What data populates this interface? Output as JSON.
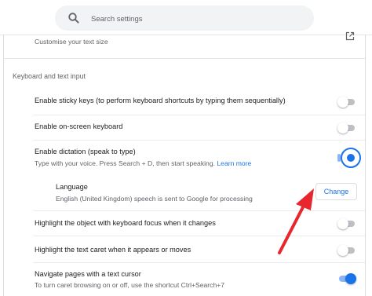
{
  "search": {
    "placeholder": "Search settings"
  },
  "text_size_row": {
    "label": "Customise your text size"
  },
  "keyboard_section": {
    "title": "Keyboard and text input",
    "sticky_keys": {
      "label": "Enable sticky keys (to perform keyboard shortcuts by typing them sequentially)",
      "enabled": false
    },
    "onscreen_keyboard": {
      "label": "Enable on-screen keyboard",
      "enabled": false
    },
    "dictation": {
      "label": "Enable dictation (speak to type)",
      "description": "Type with your voice. Press Search + D, then start speaking.",
      "learn_more": "Learn more",
      "enabled": true
    },
    "language": {
      "label": "Language",
      "description": "English (United Kingdom) speech is sent to Google for processing",
      "change_label": "Change"
    },
    "highlight_focus": {
      "label": "Highlight the object with keyboard focus when it changes",
      "enabled": false
    },
    "highlight_caret": {
      "label": "Highlight the text caret when it appears or moves",
      "enabled": false
    },
    "caret_browsing": {
      "label": "Navigate pages with a text cursor",
      "description": "To turn caret browsing on or off, use the shortcut Ctrl+Search+7",
      "enabled": true
    }
  },
  "colors": {
    "accent": "#1a73e8",
    "annotation_arrow": "#e8262e"
  },
  "icons": [
    "search-icon",
    "launch-icon",
    "annotation-arrow"
  ]
}
